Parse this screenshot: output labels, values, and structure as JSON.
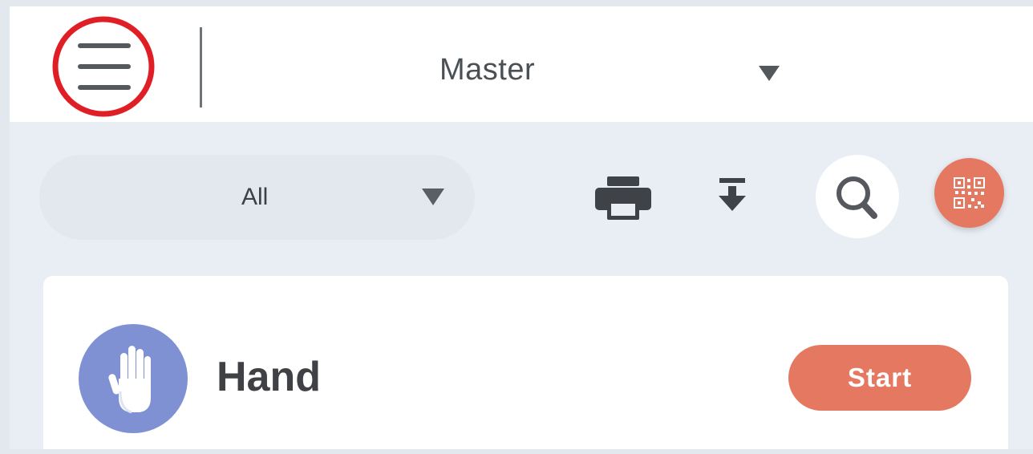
{
  "header": {
    "menu_icon": "hamburger-menu-icon",
    "annotation_color": "#e01e26",
    "branch_select": {
      "value": "Master",
      "caret_icon": "caret-down-icon"
    }
  },
  "toolbar": {
    "filter_select": {
      "value": "All",
      "caret_icon": "caret-down-icon"
    },
    "icons": {
      "print": "print-icon",
      "download": "download-icon",
      "search": "search-icon",
      "qr": "qr-code-icon"
    }
  },
  "card": {
    "icon": "hand-icon",
    "title": "Hand",
    "start_label": "Start"
  },
  "colors": {
    "accent": "#e57860",
    "avatar_bg": "#7f91d2",
    "page_bg": "#e9eef4",
    "header_bg": "#ffffff"
  }
}
